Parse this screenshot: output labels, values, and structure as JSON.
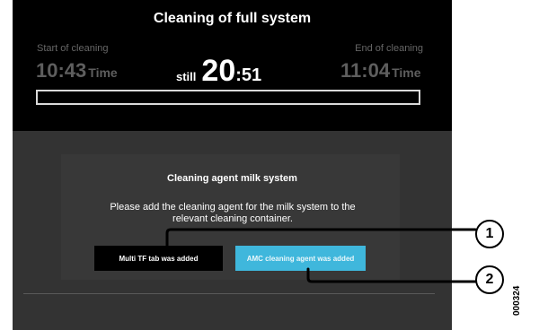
{
  "header": {
    "title": "Cleaning of full system",
    "start_label": "Start of cleaning",
    "start_time": "10:43",
    "end_label": "End of cleaning",
    "end_time": "11:04",
    "time_unit": "Time",
    "still_label": "still",
    "remaining_minutes": "20",
    "remaining_colon": ":",
    "remaining_seconds": "51",
    "progress_fraction": 0.0
  },
  "panel": {
    "heading": "Cleaning agent milk system",
    "message": "Please add the cleaning agent for the milk system to the relevant cleaning container."
  },
  "buttons": {
    "tf_label": "Multi TF tab was added",
    "amc_label": "AMC cleaning agent was added"
  },
  "callouts": [
    "1",
    "2"
  ],
  "doc_number": "000324",
  "colors": {
    "header_bg": "#000000",
    "screen_bg": "#333333",
    "accent_button": "#3fb7dc",
    "dark_button": "#000000"
  }
}
